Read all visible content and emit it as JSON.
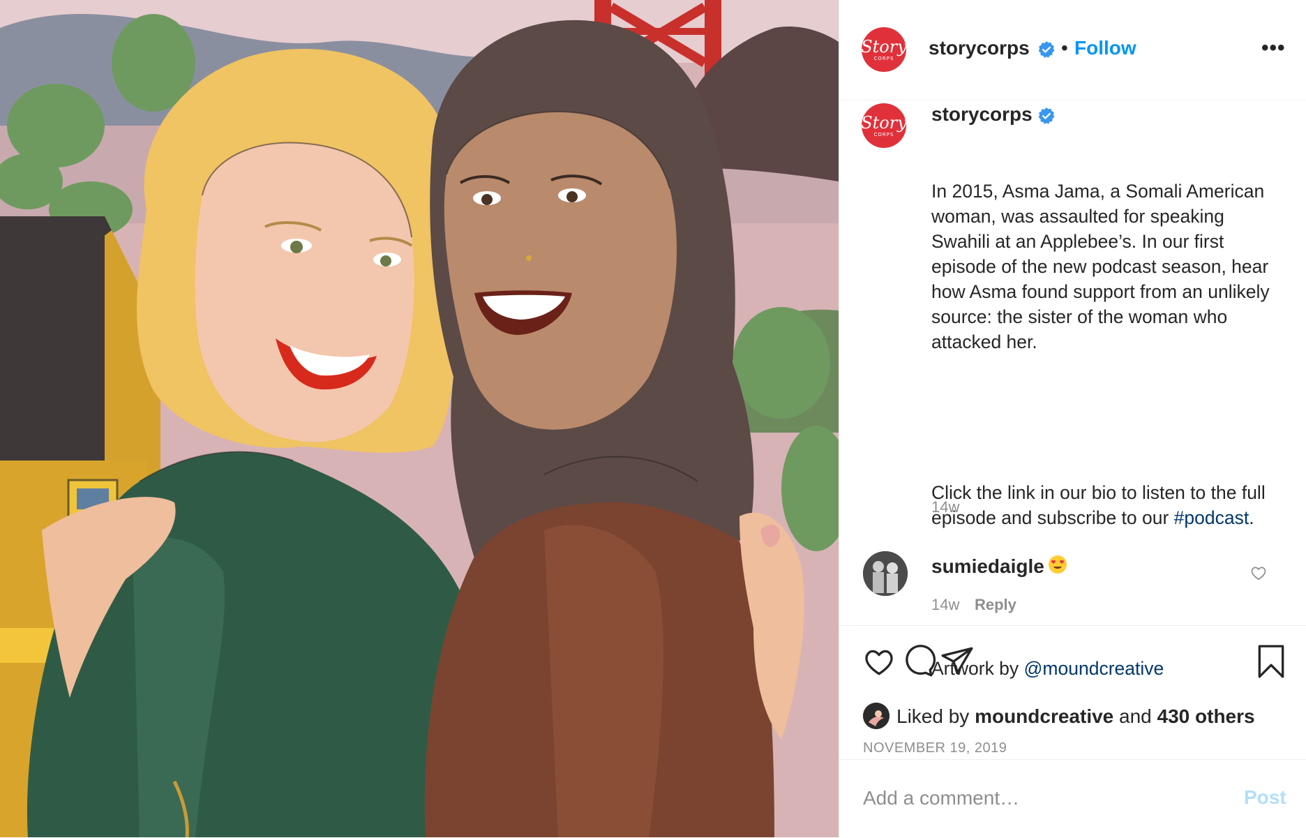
{
  "post": {
    "username": "storycorps",
    "logo_text": "Story",
    "logo_subtext": "CORPS",
    "follow_label": "Follow",
    "separator": "•",
    "more_label": "•••"
  },
  "caption": {
    "username": "storycorps",
    "paragraph1": "In 2015, Asma Jama, a Somali American woman, was assaulted for speaking Swahili at an Applebee’s. In our first episode of the new podcast season, hear how Asma found support from an unlikely source: the sister of the woman who attacked her.",
    "paragraph2_before": "Click the link in our bio to listen to the full episode and subscribe to our ",
    "hashtag": "#podcast",
    "paragraph2_after": ".",
    "artwork_prefix": "Artwork by ",
    "artwork_mention": "@moundcreative",
    "time": "14w"
  },
  "comment": {
    "username": "sumiedaigle",
    "emoji": "heart-eyes-emoji",
    "time": "14w",
    "reply_label": "Reply"
  },
  "actions": {
    "like_icon": "heart-icon",
    "comment_icon": "comment-bubble-icon",
    "share_icon": "paper-plane-icon",
    "save_icon": "bookmark-icon"
  },
  "likes": {
    "prefix": "Liked by ",
    "user": "moundcreative",
    "middle": " and ",
    "others": "430 others"
  },
  "date": "NOVEMBER 19, 2019",
  "add_comment": {
    "placeholder": "Add a comment…",
    "post_label": "Post"
  },
  "colors": {
    "brand_red": "#e0313a",
    "link_blue": "#0095f6",
    "verified_blue": "#3897f0",
    "mention_blue": "#00376b",
    "muted_gray": "#8e8e8e",
    "post_disabled": "#b2dffc"
  }
}
